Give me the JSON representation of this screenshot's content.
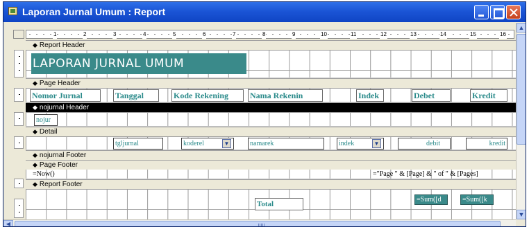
{
  "window": {
    "title": "Laporan Jurnal Umum : Report",
    "icon": "report-design-icon"
  },
  "ruler": {
    "numbers": [
      "1",
      "2",
      "3",
      "4",
      "5",
      "6",
      "7",
      "8",
      "9",
      "10",
      "11",
      "12",
      "13",
      "14",
      "15",
      "16"
    ]
  },
  "bands": {
    "report_header": "Report Header",
    "page_header": "Page Header",
    "group_header": "nojurnal Header",
    "detail": "Detail",
    "group_footer": "nojurnal Footer",
    "page_footer": "Page Footer",
    "report_footer": "Report Footer"
  },
  "report_header": {
    "title_label": "LAPORAN JURNAL UMUM"
  },
  "page_header": {
    "labels": [
      "Nomor Jurnal",
      "Tanggal",
      "Kode Rekening",
      "Nama Rekenin",
      "Indek",
      "Debet",
      "Kredit"
    ]
  },
  "group_header": {
    "field": "nojur"
  },
  "detail": {
    "fields": [
      "tgljurnal",
      "koderel",
      "namarek",
      "indek",
      "debit",
      "kredit"
    ]
  },
  "page_footer": {
    "now_expr": "=Now()",
    "page_expr": "=\"Page \" & [Page] & \" of \" & [Pages]"
  },
  "report_footer": {
    "total_label": "Total",
    "sum_debit": "=Sum([d",
    "sum_kredit": "=Sum([k"
  },
  "colors": {
    "title_bar": "#1b55d6",
    "control_teal": "#3a8a8a",
    "label_text": "#2a8a8a"
  }
}
